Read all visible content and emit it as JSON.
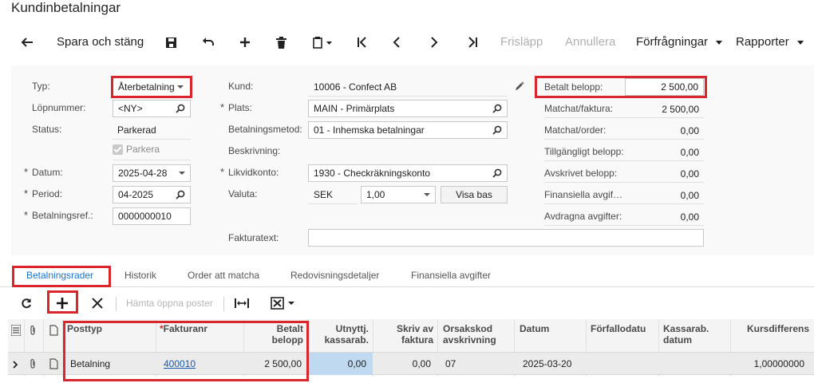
{
  "page": {
    "title": "Kundinbetalningar"
  },
  "toolbar": {
    "save_close": "Spara och stäng",
    "release": "Frisläpp",
    "cancel": "Annullera",
    "inquiries": "Förfrågningar",
    "reports": "Rapporter"
  },
  "form": {
    "type_label": "Typ:",
    "type_value": "Återbetalning",
    "refnbr_label": "Löpnummer:",
    "refnbr_value": "<NY>",
    "status_label": "Status:",
    "status_value": "Parkerad",
    "hold_label": "Parkera",
    "date_label": "Datum:",
    "date_value": "2025-04-28",
    "period_label": "Period:",
    "period_value": "04-2025",
    "payref_label": "Betalningsref.:",
    "payref_value": "0000000010",
    "customer_label": "Kund:",
    "customer_value": "10006 - Confect AB",
    "location_label": "Plats:",
    "location_value": "MAIN - Primärplats",
    "method_label": "Betalningsmetod:",
    "method_value": "01 - Inhemska betalningar",
    "desc_label": "Beskrivning:",
    "cash_label": "Likvidkonto:",
    "cash_value": "1930 - Checkräkningskonto",
    "currency_label": "Valuta:",
    "currency_value": "SEK",
    "rate_value": "1,00",
    "view_base": "Visa bas",
    "invoicetext_label": "Fakturatext:"
  },
  "summary": {
    "paid_label": "Betalt belopp:",
    "paid_value": "2 500,00",
    "applied_inv_label": "Matchat/faktura:",
    "applied_inv_value": "2 500,00",
    "applied_ord_label": "Matchat/order:",
    "applied_ord_value": "0,00",
    "available_label": "Tillgängligt belopp:",
    "available_value": "0,00",
    "writeoff_label": "Avskrivet belopp:",
    "writeoff_value": "0,00",
    "fincharge_label": "Finansiella avgif…",
    "fincharge_value": "0,00",
    "deducted_label": "Avdragna avgifter:",
    "deducted_value": "0,00"
  },
  "tabs": [
    "Betalningsrader",
    "Historik",
    "Order att matcha",
    "Redovisningsdetaljer",
    "Finansiella avgifter"
  ],
  "gridtoolbar": {
    "load_open": "Hämta öppna poster"
  },
  "grid": {
    "headers": {
      "doctype": "Posttyp",
      "refnbr": "Fakturanr",
      "paid1": "Betalt",
      "paid2": "belopp",
      "disc1": "Utnyttj.",
      "disc2": "kassarab.",
      "wo1": "Skriv av",
      "wo2": "faktura",
      "reason1": "Orsakskod",
      "reason2": "avskrivning",
      "date": "Datum",
      "due": "Förfallodatu",
      "discdate1": "Kassarab.",
      "discdate2": "datum",
      "rate": "Kursdifferens"
    },
    "row": {
      "doctype": "Betalning",
      "refnbr": "400010",
      "paid": "2 500,00",
      "disc": "0,00",
      "wo": "0,00",
      "reason": "07",
      "date": "2025-03-20",
      "rate": "1,00000000"
    }
  }
}
